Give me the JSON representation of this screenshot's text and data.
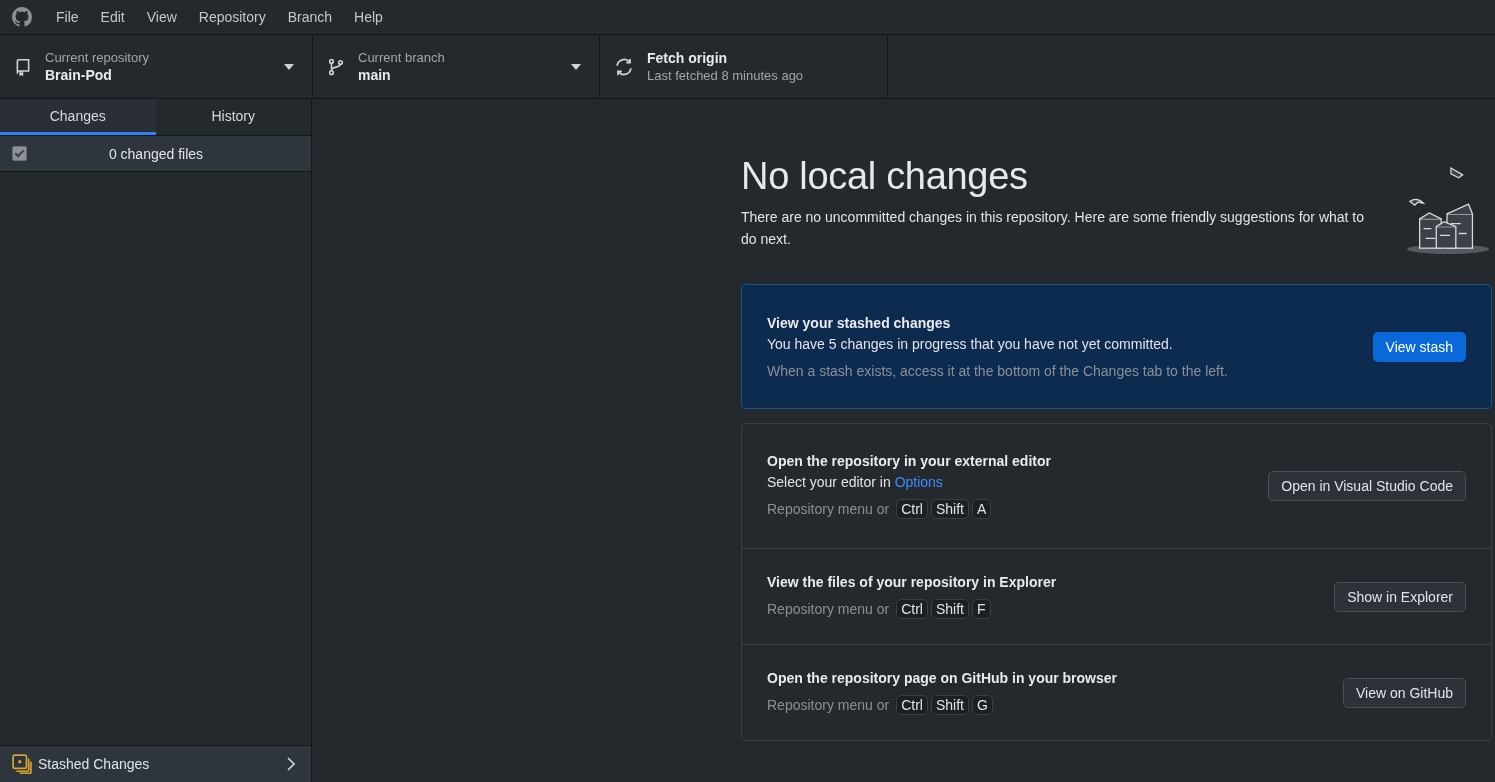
{
  "menu": [
    "File",
    "Edit",
    "View",
    "Repository",
    "Branch",
    "Help"
  ],
  "toolbar": {
    "repository": {
      "label": "Current repository",
      "value": "Brain-Pod"
    },
    "branch": {
      "label": "Current branch",
      "value": "main"
    },
    "fetch": {
      "title": "Fetch origin",
      "subtitle": "Last fetched 8 minutes ago"
    }
  },
  "tabs": [
    {
      "label": "Changes",
      "selected": true
    },
    {
      "label": "History",
      "selected": false
    }
  ],
  "changes": {
    "checked": true,
    "label": "0 changed files"
  },
  "stashed_footer": {
    "label": "Stashed Changes"
  },
  "main": {
    "title": "No local changes",
    "description": "There are no uncommitted changes in this repository. Here are some friendly suggestions for what to do next.",
    "stash_card": {
      "title": "View your stashed changes",
      "text": "You have 5 changes in progress that you have not yet committed.",
      "hint": "When a stash exists, access it at the bottom of the Changes tab to the left.",
      "button": "View stash"
    },
    "suggestions": [
      {
        "title": "Open the repository in your external editor",
        "text": "Select your editor in",
        "link": "Options",
        "shortcut_prefix": "Repository menu or",
        "keys": [
          "Ctrl",
          "Shift",
          "A"
        ],
        "button": "Open in Visual Studio Code"
      },
      {
        "title": "View the files of your repository in Explorer",
        "shortcut_prefix": "Repository menu or",
        "keys": [
          "Ctrl",
          "Shift",
          "F"
        ],
        "button": "Show in Explorer"
      },
      {
        "title": "Open the repository page on GitHub in your browser",
        "shortcut_prefix": "Repository menu or",
        "keys": [
          "Ctrl",
          "Shift",
          "G"
        ],
        "button": "View on GitHub"
      }
    ]
  }
}
